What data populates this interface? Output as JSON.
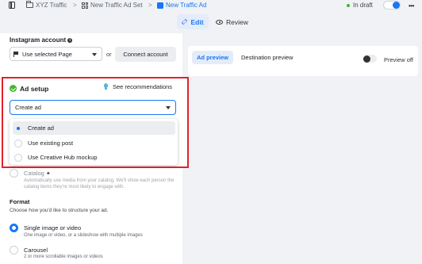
{
  "breadcrumbs": [
    {
      "label": "XYZ Traffic",
      "icon": "folder-icon"
    },
    {
      "label": "New Traffic Ad Set",
      "icon": "grid-icon"
    },
    {
      "label": "New Traffic Ad",
      "icon": "ad-icon"
    }
  ],
  "separator": ">",
  "status": {
    "label": "In draft",
    "color": "#42b72a"
  },
  "more": "•••",
  "tabs": {
    "edit": "Edit",
    "review": "Review"
  },
  "instagram": {
    "title": "Instagram account",
    "page_select": "Use selected Page",
    "or": "or",
    "connect": "Connect account"
  },
  "ad_setup": {
    "title": "Ad setup",
    "see_recommendations": "See recommendations",
    "selected": "Create ad",
    "options": [
      {
        "label": "Create ad",
        "selected": true
      },
      {
        "label": "Use existing post",
        "selected": false
      },
      {
        "label": "Use Creative Hub mockup",
        "selected": false
      }
    ]
  },
  "catalog": {
    "title": "Catalog",
    "description": "Automatically use media from your catalog. We'll show each person the catalog items they're most likely to engage with."
  },
  "format": {
    "title": "Format",
    "subtitle": "Choose how you'd like to structure your ad.",
    "options": [
      {
        "title": "Single image or video",
        "desc": "One image or video, or a slideshow with multiple images",
        "selected": true
      },
      {
        "title": "Carousel",
        "desc": "2 or more scrollable images or videos",
        "selected": false
      }
    ]
  },
  "preview": {
    "ad_preview": "Ad preview",
    "destination_preview": "Destination preview",
    "preview_off": "Preview off"
  },
  "colors": {
    "accent": "#1877f2",
    "highlight": "#e4202c",
    "success": "#42b72a"
  }
}
